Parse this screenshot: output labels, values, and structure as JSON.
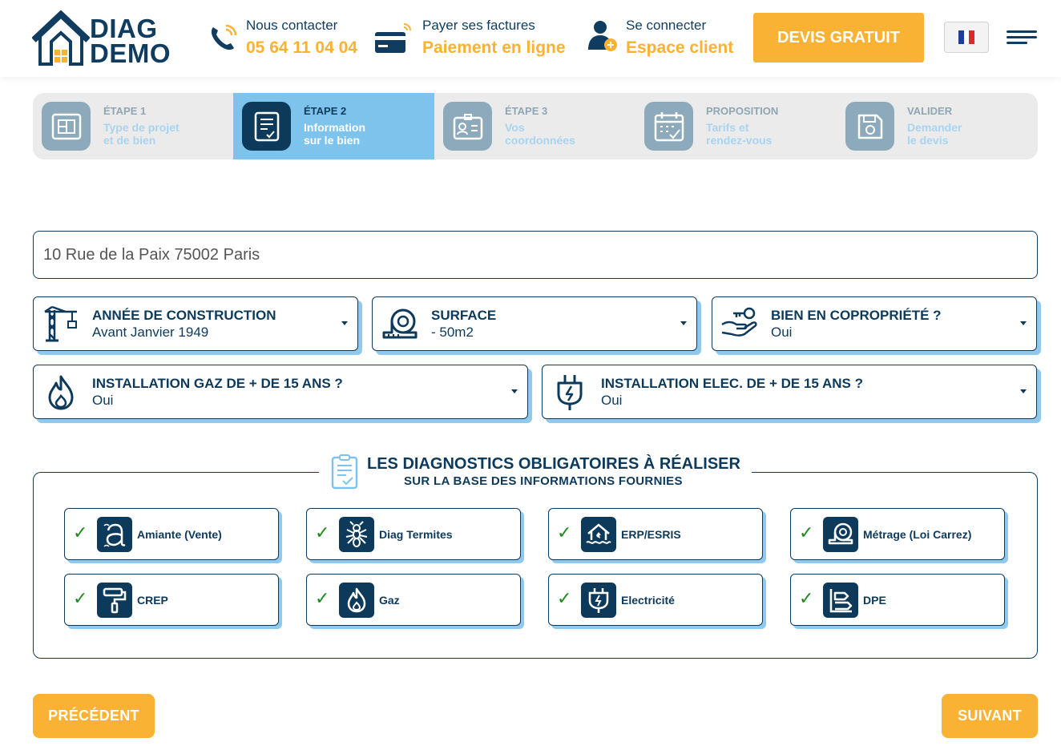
{
  "brand": {
    "name_line1": "DIAG",
    "name_line2": "DEMO"
  },
  "header": {
    "contact": {
      "label": "Nous contacter",
      "value": "05 64 11 04 04",
      "icon": "phone-icon"
    },
    "payment": {
      "label": "Payer ses factures",
      "value": "Paiement en ligne",
      "icon": "credit-card-icon"
    },
    "login": {
      "label": "Se connecter",
      "value": "Espace client",
      "icon": "user-icon"
    },
    "cta_label": "DEVIS GRATUIT",
    "language_flag": "french-flag-icon",
    "menu_icon": "hamburger-menu-icon"
  },
  "steps": [
    {
      "label": "ÉTAPE 1",
      "line1": "Type de projet",
      "line2": "et de bien",
      "icon": "blueprint-icon",
      "active": false
    },
    {
      "label": "ÉTAPE 2",
      "line1": "Information",
      "line2": "sur le bien",
      "icon": "checklist-icon",
      "active": true
    },
    {
      "label": "ÉTAPE 3",
      "line1": "Vos",
      "line2": "coordonnées",
      "icon": "id-card-icon",
      "active": false
    },
    {
      "label": "PROPOSITION",
      "line1": "Tarifs et",
      "line2": "rendez-vous",
      "icon": "calendar-icon",
      "active": false
    },
    {
      "label": "VALIDER",
      "line1": "Demander",
      "line2": "le devis",
      "icon": "save-icon",
      "active": false
    }
  ],
  "address": {
    "value": "10 Rue de la Paix 75002 Paris"
  },
  "fields": {
    "construction_year": {
      "label": "ANNÉE DE CONSTRUCTION",
      "value": "Avant Janvier 1949",
      "icon": "crane-icon"
    },
    "surface": {
      "label": "SURFACE",
      "value": "- 50m2",
      "icon": "tape-measure-icon"
    },
    "copropriete": {
      "label": "BIEN EN COPROPRIÉTÉ ?",
      "value": "Oui",
      "icon": "hand-key-icon"
    },
    "gas": {
      "label": "INSTALLATION GAZ DE + DE 15 ANS ?",
      "value": "Oui",
      "icon": "flame-icon"
    },
    "elec": {
      "label": "INSTALLATION ELEC. DE + DE 15 ANS ?",
      "value": "Oui",
      "icon": "plug-icon"
    }
  },
  "diagnostics": {
    "title": "LES DIAGNOSTICS OBLIGATOIRES À RÉALISER",
    "subtitle": "SUR LA BASE DES INFORMATIONS FOURNIES",
    "items": [
      {
        "label": "Amiante (Vente)",
        "icon": "asbestos-icon",
        "checked": true
      },
      {
        "label": "Diag Termites",
        "icon": "termite-icon",
        "checked": true
      },
      {
        "label": "ERP/ESRIS",
        "icon": "flood-house-icon",
        "checked": true
      },
      {
        "label": "Métrage (Loi Carrez)",
        "icon": "tape-measure-icon",
        "checked": true
      },
      {
        "label": "CREP",
        "icon": "paint-roller-icon",
        "checked": true
      },
      {
        "label": "Gaz",
        "icon": "flame-icon",
        "checked": true
      },
      {
        "label": "Electricité",
        "icon": "plug-icon",
        "checked": true
      },
      {
        "label": "DPE",
        "icon": "energy-label-icon",
        "checked": true
      }
    ],
    "check_mark": "✓"
  },
  "navigation": {
    "previous_label": "PRÉCÉDENT",
    "next_label": "SUIVANT"
  },
  "colors": {
    "primary": "#0d3a5b",
    "accent": "#f9b233",
    "active_step": "#7ec3ec",
    "shadow": "#8fc9ee",
    "check": "#1f8a1f"
  }
}
